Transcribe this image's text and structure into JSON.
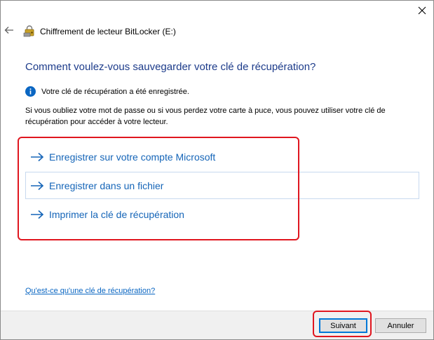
{
  "window": {
    "title": "Chiffrement de lecteur BitLocker (E:)",
    "close_icon": "close-icon",
    "back_icon": "back-arrow-icon",
    "app_icon": "bitlocker-icon"
  },
  "main": {
    "heading": "Comment voulez-vous sauvegarder votre clé de récupération?",
    "info": {
      "icon": "info-icon",
      "text": "Votre clé de récupération a été enregistrée."
    },
    "description": "Si vous oubliez votre mot de passe ou si vous perdez votre carte à puce, vous pouvez utiliser votre clé de récupération pour accéder à votre lecteur.",
    "options": [
      {
        "label": "Enregistrer sur votre compte Microsoft",
        "icon": "arrow-right-icon"
      },
      {
        "label": "Enregistrer dans un fichier",
        "icon": "arrow-right-icon",
        "hovered": true
      },
      {
        "label": "Imprimer la clé de récupération",
        "icon": "arrow-right-icon"
      }
    ],
    "help_link": "Qu'est-ce qu'une clé de récupération?"
  },
  "footer": {
    "next_label": "Suivant",
    "cancel_label": "Annuler"
  },
  "colors": {
    "heading": "#1c3b8a",
    "link": "#1565b8",
    "highlight": "#e0161f",
    "info": "#0a66c2"
  }
}
